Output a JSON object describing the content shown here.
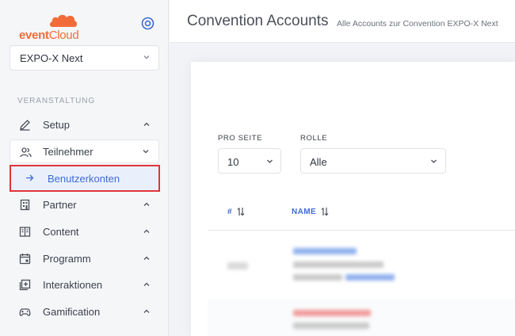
{
  "sidebar": {
    "brand_part1": "event",
    "brand_part2": "Cloud",
    "event_select": "EXPO-X Next",
    "section_label": "VERANSTALTUNG",
    "items": [
      {
        "label": "Setup"
      },
      {
        "label": "Teilnehmer"
      },
      {
        "label": "Benutzerkonten"
      },
      {
        "label": "Partner"
      },
      {
        "label": "Content"
      },
      {
        "label": "Programm"
      },
      {
        "label": "Interaktionen"
      },
      {
        "label": "Gamification"
      }
    ]
  },
  "header": {
    "title": "Convention Accounts",
    "subtitle": "Alle Accounts zur Convention EXPO-X Next"
  },
  "filters": {
    "per_page_label": "PRO SEITE",
    "per_page_value": "10",
    "role_label": "ROLLE",
    "role_value": "Alle"
  },
  "table": {
    "col_id": "#",
    "col_name": "NAME"
  },
  "colors": {
    "accent": "#3e6bd4",
    "brand": "#f26c3a",
    "highlight_border": "#e0343b"
  }
}
